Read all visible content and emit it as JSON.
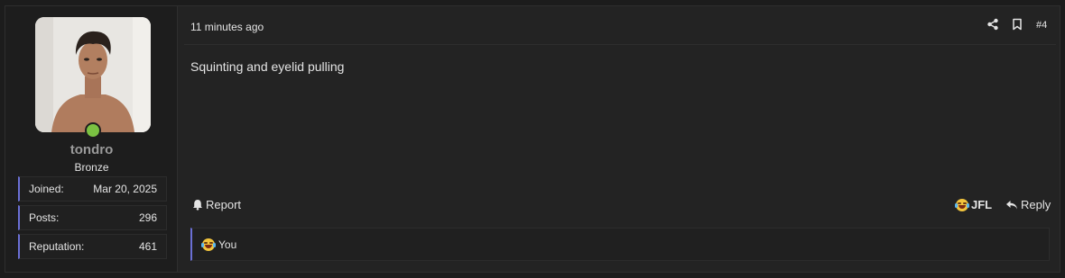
{
  "user": {
    "username": "tondro",
    "title": "Bronze",
    "status_color": "#7ac142",
    "stats": [
      {
        "label": "Joined:",
        "value": "Mar 20, 2025"
      },
      {
        "label": "Posts:",
        "value": "296"
      },
      {
        "label": "Reputation:",
        "value": "461"
      }
    ]
  },
  "post": {
    "time": "11 minutes ago",
    "number": "#4",
    "message": "Squinting and eyelid pulling",
    "actions": {
      "share_icon": "share-icon",
      "bookmark_icon": "bookmark-icon"
    }
  },
  "footer": {
    "report_label": "Report",
    "reaction_label": "JFL",
    "reply_label": "Reply"
  },
  "reactions": {
    "reactors": "You",
    "emoji": "laughing-crying-emoji"
  },
  "colors": {
    "accent": "#6a6fd4",
    "background": "#232323"
  }
}
